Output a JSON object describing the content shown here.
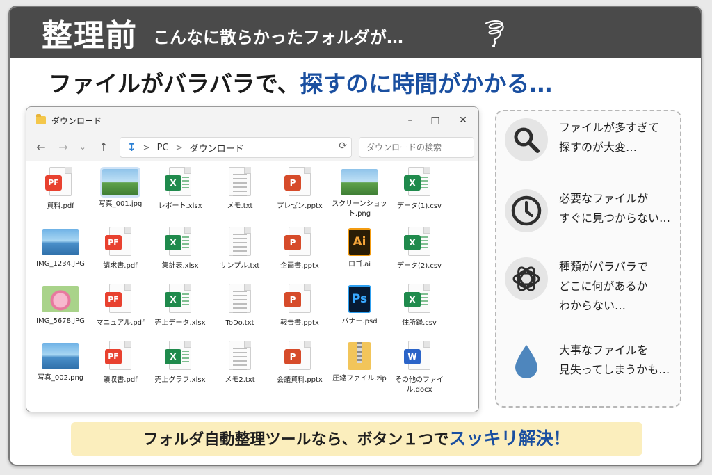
{
  "header": {
    "main": "整理前",
    "sub": "こんなに散らかったフォルダが…"
  },
  "headline": {
    "text": "ファイルがバラバラで、",
    "accent": "探すのに時間がかかる…"
  },
  "explorer": {
    "title": "ダウンロード",
    "address_pc": "PC",
    "address_folder": "ダウンロード",
    "search_placeholder": "ダウンロードの検索",
    "files": [
      {
        "name": "資料.pdf",
        "type": "pdf"
      },
      {
        "name": "写真_001.jpg",
        "type": "photo-land"
      },
      {
        "name": "レポート.xlsx",
        "type": "xlsx"
      },
      {
        "name": "メモ.txt",
        "type": "txt"
      },
      {
        "name": "プレゼン.pptx",
        "type": "pptx"
      },
      {
        "name": "スクリーンショット.png",
        "type": "photo-land"
      },
      {
        "name": "データ(1).csv",
        "type": "xlsx"
      },
      {
        "name": "IMG_1234.JPG",
        "type": "photo-lake"
      },
      {
        "name": "請求書.pdf",
        "type": "pdf"
      },
      {
        "name": "集計表.xlsx",
        "type": "xlsx"
      },
      {
        "name": "サンプル.txt",
        "type": "txt"
      },
      {
        "name": "企画書.pptx",
        "type": "pptx"
      },
      {
        "name": "ロゴ.ai",
        "type": "ai"
      },
      {
        "name": "データ(2).csv",
        "type": "xlsx"
      },
      {
        "name": "IMG_5678.JPG",
        "type": "photo-flower"
      },
      {
        "name": "マニュアル.pdf",
        "type": "pdf"
      },
      {
        "name": "売上データ.xlsx",
        "type": "xlsx"
      },
      {
        "name": "ToDo.txt",
        "type": "txt"
      },
      {
        "name": "報告書.pptx",
        "type": "pptx"
      },
      {
        "name": "バナー.psd",
        "type": "psd"
      },
      {
        "name": "住所録.csv",
        "type": "xlsx"
      },
      {
        "name": "写真_002.png",
        "type": "photo-lake"
      },
      {
        "name": "領収書.pdf",
        "type": "pdf"
      },
      {
        "name": "売上グラフ.xlsx",
        "type": "xlsx"
      },
      {
        "name": "メモ2.txt",
        "type": "txt"
      },
      {
        "name": "会議資料.pptx",
        "type": "pptx"
      },
      {
        "name": "圧縮ファイル.zip",
        "type": "zip"
      },
      {
        "name": "その他のファイル.docx",
        "type": "docx"
      }
    ]
  },
  "side": {
    "items": [
      {
        "icon": "magnifier-icon",
        "text": "ファイルが多すぎて\n探すのが大変…"
      },
      {
        "icon": "clock-icon",
        "text": "必要なファイルが\nすぐに見つからない…"
      },
      {
        "icon": "tangle-icon",
        "text": "種類がバラバラで\nどこに何があるか\nわからない…"
      },
      {
        "icon": "drop-icon",
        "text": "大事なファイルを\n見失ってしまうかも…"
      }
    ]
  },
  "banner": {
    "text": "フォルダ自動整理ツールなら、ボタン１つで",
    "accent": "スッキリ解決！"
  },
  "colors": {
    "header_bg": "#4a4a4a",
    "accent_blue": "#1a4fa0",
    "banner_bg": "#fbeebd"
  }
}
